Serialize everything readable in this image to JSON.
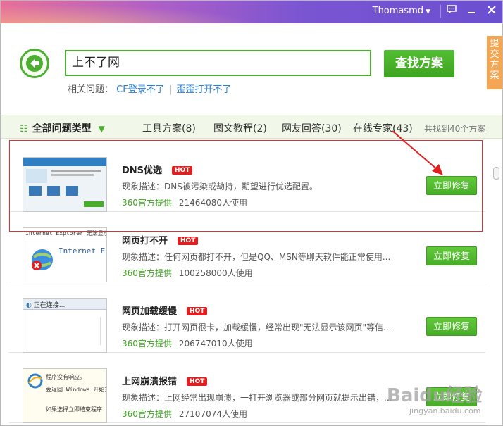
{
  "titlebar": {
    "username": "Thomasmd",
    "colors": {
      "start": "#e7709a",
      "end": "#6a4fd0"
    }
  },
  "search": {
    "value": "上不了网",
    "button_label": "查找方案"
  },
  "related": {
    "label": "相关问题：",
    "links": [
      "CF登录不了",
      "歪歪打开不了"
    ]
  },
  "side_tab": {
    "label": "提交方案"
  },
  "categories": {
    "all_label": "全部问题类型",
    "tabs": [
      "工具方案(8)",
      "图文教程(2)",
      "网友回答(30)",
      "在线专家(43)"
    ],
    "count_text": "共找到40个方案"
  },
  "items": [
    {
      "title": "DNS优选",
      "hot": "HOT",
      "desc": "现象描述：DNS被污染或劫持，期望进行优选配置。",
      "provider": "360官方提供",
      "users": "21464080人使用",
      "button": "立即修复",
      "thumb": "dns"
    },
    {
      "title": "网页打不开",
      "hot": "HOT",
      "desc": "现象描述：任何网页都打不开，但是QQ、MSN等聊天软件能正常使用...",
      "provider": "360官方提供",
      "users": "100258000人使用",
      "button": "立即修复",
      "thumb": "ie-error",
      "thumb_text": "Internet Explorer 无法显示",
      "thumb_text2": "Internet Exp"
    },
    {
      "title": "网页加载缓慢",
      "hot": "HOT",
      "desc": "现象描述：打开网页很卡，加载缓慢，经常出现\"无法显示该网页\"等信...",
      "provider": "360官方提供",
      "users": "206747010人使用",
      "button": "立即修复",
      "thumb": "connecting",
      "thumb_text": "正在连接..."
    },
    {
      "title": "上网崩溃报错",
      "hot": "HOT",
      "desc": "现象描述：上网经常出现崩溃，一打开浏览器或部分网页就提示出错，...",
      "provider": "360官方提供",
      "users": "27107074人使用",
      "button": "立即修复",
      "thumb": "crash",
      "thumb_text": "程序没有响应。",
      "thumb_text2": "要返回 Windows 开始查清",
      "thumb_text3": "如果选择立即结束程序"
    }
  ],
  "watermark": {
    "text": "Baidu经验",
    "sub": "jingyan.baidu.com"
  },
  "icons": [
    "back-arrow-icon",
    "feedback-icon",
    "minimize-icon",
    "close-icon",
    "grid-icon",
    "chevron-down-icon"
  ]
}
